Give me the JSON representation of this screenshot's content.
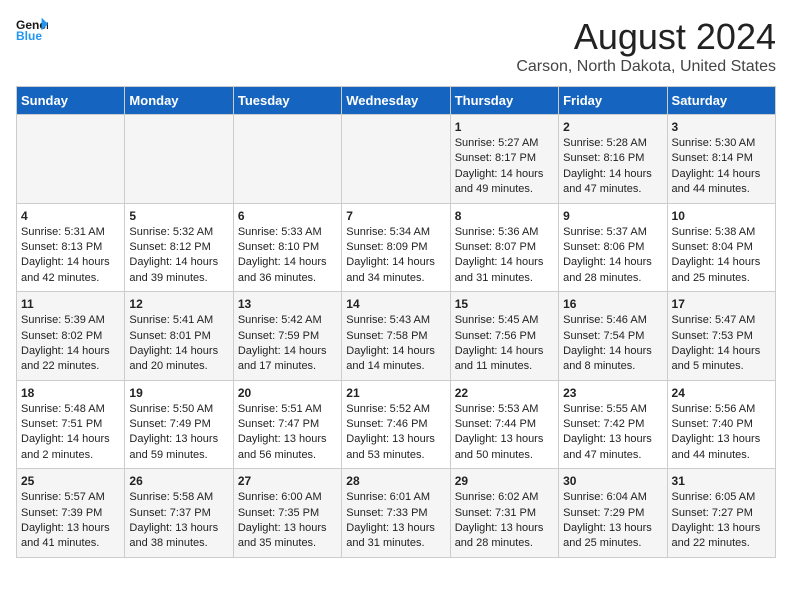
{
  "header": {
    "logo_line1": "General",
    "logo_line2": "Blue",
    "title": "August 2024",
    "subtitle": "Carson, North Dakota, United States"
  },
  "days_of_week": [
    "Sunday",
    "Monday",
    "Tuesday",
    "Wednesday",
    "Thursday",
    "Friday",
    "Saturday"
  ],
  "weeks": [
    {
      "days": [
        {
          "num": "",
          "info": ""
        },
        {
          "num": "",
          "info": ""
        },
        {
          "num": "",
          "info": ""
        },
        {
          "num": "",
          "info": ""
        },
        {
          "num": "1",
          "info": "Sunrise: 5:27 AM\nSunset: 8:17 PM\nDaylight: 14 hours\nand 49 minutes."
        },
        {
          "num": "2",
          "info": "Sunrise: 5:28 AM\nSunset: 8:16 PM\nDaylight: 14 hours\nand 47 minutes."
        },
        {
          "num": "3",
          "info": "Sunrise: 5:30 AM\nSunset: 8:14 PM\nDaylight: 14 hours\nand 44 minutes."
        }
      ]
    },
    {
      "days": [
        {
          "num": "4",
          "info": "Sunrise: 5:31 AM\nSunset: 8:13 PM\nDaylight: 14 hours\nand 42 minutes."
        },
        {
          "num": "5",
          "info": "Sunrise: 5:32 AM\nSunset: 8:12 PM\nDaylight: 14 hours\nand 39 minutes."
        },
        {
          "num": "6",
          "info": "Sunrise: 5:33 AM\nSunset: 8:10 PM\nDaylight: 14 hours\nand 36 minutes."
        },
        {
          "num": "7",
          "info": "Sunrise: 5:34 AM\nSunset: 8:09 PM\nDaylight: 14 hours\nand 34 minutes."
        },
        {
          "num": "8",
          "info": "Sunrise: 5:36 AM\nSunset: 8:07 PM\nDaylight: 14 hours\nand 31 minutes."
        },
        {
          "num": "9",
          "info": "Sunrise: 5:37 AM\nSunset: 8:06 PM\nDaylight: 14 hours\nand 28 minutes."
        },
        {
          "num": "10",
          "info": "Sunrise: 5:38 AM\nSunset: 8:04 PM\nDaylight: 14 hours\nand 25 minutes."
        }
      ]
    },
    {
      "days": [
        {
          "num": "11",
          "info": "Sunrise: 5:39 AM\nSunset: 8:02 PM\nDaylight: 14 hours\nand 22 minutes."
        },
        {
          "num": "12",
          "info": "Sunrise: 5:41 AM\nSunset: 8:01 PM\nDaylight: 14 hours\nand 20 minutes."
        },
        {
          "num": "13",
          "info": "Sunrise: 5:42 AM\nSunset: 7:59 PM\nDaylight: 14 hours\nand 17 minutes."
        },
        {
          "num": "14",
          "info": "Sunrise: 5:43 AM\nSunset: 7:58 PM\nDaylight: 14 hours\nand 14 minutes."
        },
        {
          "num": "15",
          "info": "Sunrise: 5:45 AM\nSunset: 7:56 PM\nDaylight: 14 hours\nand 11 minutes."
        },
        {
          "num": "16",
          "info": "Sunrise: 5:46 AM\nSunset: 7:54 PM\nDaylight: 14 hours\nand 8 minutes."
        },
        {
          "num": "17",
          "info": "Sunrise: 5:47 AM\nSunset: 7:53 PM\nDaylight: 14 hours\nand 5 minutes."
        }
      ]
    },
    {
      "days": [
        {
          "num": "18",
          "info": "Sunrise: 5:48 AM\nSunset: 7:51 PM\nDaylight: 14 hours\nand 2 minutes."
        },
        {
          "num": "19",
          "info": "Sunrise: 5:50 AM\nSunset: 7:49 PM\nDaylight: 13 hours\nand 59 minutes."
        },
        {
          "num": "20",
          "info": "Sunrise: 5:51 AM\nSunset: 7:47 PM\nDaylight: 13 hours\nand 56 minutes."
        },
        {
          "num": "21",
          "info": "Sunrise: 5:52 AM\nSunset: 7:46 PM\nDaylight: 13 hours\nand 53 minutes."
        },
        {
          "num": "22",
          "info": "Sunrise: 5:53 AM\nSunset: 7:44 PM\nDaylight: 13 hours\nand 50 minutes."
        },
        {
          "num": "23",
          "info": "Sunrise: 5:55 AM\nSunset: 7:42 PM\nDaylight: 13 hours\nand 47 minutes."
        },
        {
          "num": "24",
          "info": "Sunrise: 5:56 AM\nSunset: 7:40 PM\nDaylight: 13 hours\nand 44 minutes."
        }
      ]
    },
    {
      "days": [
        {
          "num": "25",
          "info": "Sunrise: 5:57 AM\nSunset: 7:39 PM\nDaylight: 13 hours\nand 41 minutes."
        },
        {
          "num": "26",
          "info": "Sunrise: 5:58 AM\nSunset: 7:37 PM\nDaylight: 13 hours\nand 38 minutes."
        },
        {
          "num": "27",
          "info": "Sunrise: 6:00 AM\nSunset: 7:35 PM\nDaylight: 13 hours\nand 35 minutes."
        },
        {
          "num": "28",
          "info": "Sunrise: 6:01 AM\nSunset: 7:33 PM\nDaylight: 13 hours\nand 31 minutes."
        },
        {
          "num": "29",
          "info": "Sunrise: 6:02 AM\nSunset: 7:31 PM\nDaylight: 13 hours\nand 28 minutes."
        },
        {
          "num": "30",
          "info": "Sunrise: 6:04 AM\nSunset: 7:29 PM\nDaylight: 13 hours\nand 25 minutes."
        },
        {
          "num": "31",
          "info": "Sunrise: 6:05 AM\nSunset: 7:27 PM\nDaylight: 13 hours\nand 22 minutes."
        }
      ]
    }
  ]
}
